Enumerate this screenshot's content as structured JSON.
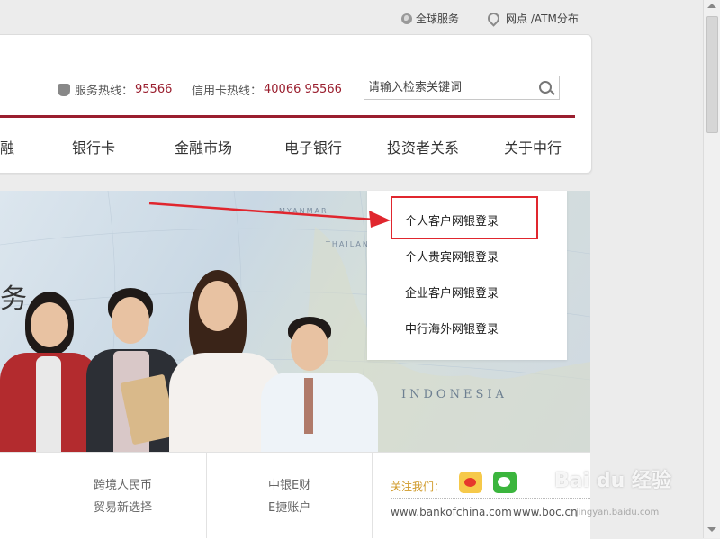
{
  "top_links": {
    "global": "全球服务",
    "branches": "网点 /ATM分布"
  },
  "hotlines": {
    "service_label": "服务热线：",
    "service_number": "95566",
    "card_label": "信用卡热线：",
    "card_number": "40066 95566"
  },
  "search": {
    "placeholder": "请输入检索关键词"
  },
  "nav": {
    "partial": "融",
    "items": [
      "银行卡",
      "金融市场",
      "电子银行",
      "投资者关系",
      "关于中行"
    ]
  },
  "banner": {
    "partial_text": "务",
    "map_labels": [
      "MYANMAR",
      "THAILAND",
      "INDONESIA"
    ]
  },
  "dropdown": {
    "items": [
      "个人客户网银登录",
      "个人贵宾网银登录",
      "企业客户网银登录",
      "中行海外网银登录"
    ]
  },
  "bottom": {
    "col1_line1": "跨境人民币",
    "col1_line2": "贸易新选择",
    "col2_line1": "中银E财",
    "col2_line2": "E捷账户",
    "follow_label": "关注我们：",
    "url1": "www.bankofchina.com",
    "url2": "www.boc.cn"
  },
  "watermark": {
    "text": "Bai du 经验",
    "url": "jingyan.baidu.com"
  },
  "colors": {
    "brand_red": "#9a1e2e",
    "highlight_red": "#e0262e",
    "follow_gold": "#d09a2a"
  }
}
